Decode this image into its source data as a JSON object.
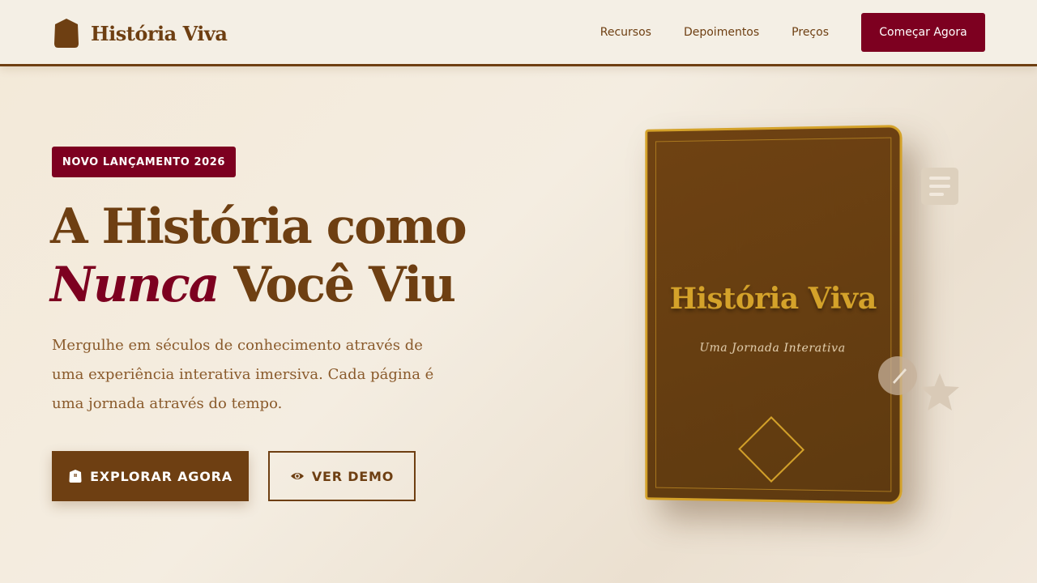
{
  "nav": {
    "brand": "História Viva",
    "links": [
      "Recursos",
      "Depoimentos",
      "Preços"
    ],
    "cta": "Começar Agora"
  },
  "hero": {
    "badge": "NOVO LANÇAMENTO 2026",
    "title_line1": "A História como",
    "title_accent": "Nunca",
    "title_line2_rest": "Você Viu",
    "description": "Mergulhe em séculos de conhecimento através de uma experiência interativa imersiva. Cada página é uma jornada através do tempo.",
    "primary_button": "EXPLORAR AGORA",
    "secondary_button": "VER DEMO"
  },
  "book": {
    "title": "História Viva",
    "subtitle": "Uma Jornada Interativa"
  },
  "icons": {
    "brand": "shield-icon",
    "primary_button": "shield-icon",
    "secondary_button": "eye-icon",
    "decor": [
      "document-icon",
      "quill-icon",
      "star-icon"
    ]
  },
  "colors": {
    "primary_brown": "#6e3f12",
    "burgundy": "#7d0020",
    "gold": "#d4a22a",
    "background": "#f3ece1"
  }
}
